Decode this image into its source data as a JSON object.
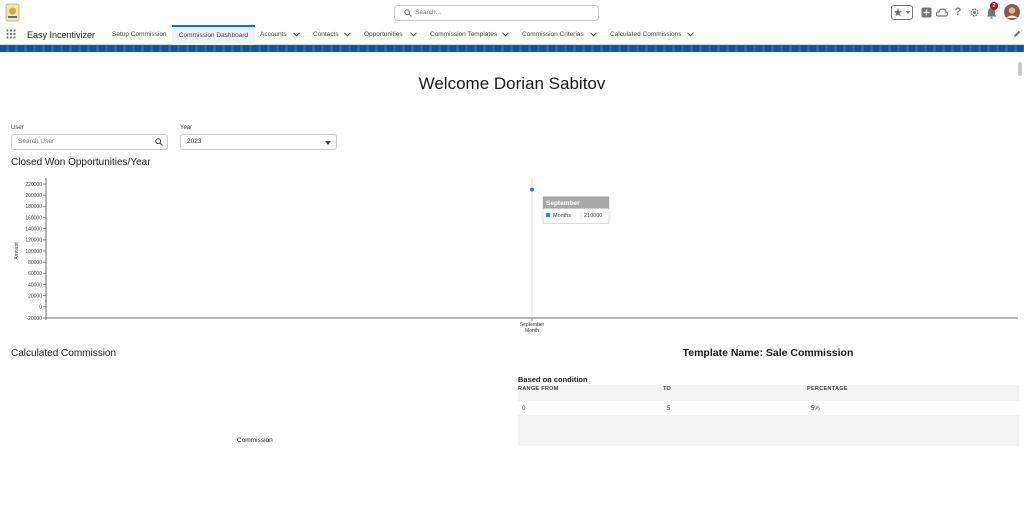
{
  "header": {
    "search_placeholder": "Search...",
    "notification_count": "2"
  },
  "nav": {
    "app_name": "Easy Incentivizer",
    "tabs": [
      {
        "label": "Setup Commission",
        "dropdown": false
      },
      {
        "label": "Commission Dashboard",
        "dropdown": false,
        "active": true
      },
      {
        "label": "Accounts",
        "dropdown": true
      },
      {
        "label": "Contacts",
        "dropdown": true
      },
      {
        "label": "Opportunities",
        "dropdown": true
      },
      {
        "label": "Commission Templates",
        "dropdown": true
      },
      {
        "label": "Commission Criterias",
        "dropdown": true
      },
      {
        "label": "Calculated Commissions",
        "dropdown": true
      }
    ]
  },
  "page": {
    "welcome": "Welcome Dorian Sabitov",
    "user_label": "User",
    "user_placeholder": "Search User",
    "year_label": "Year",
    "year_value": "2023"
  },
  "sections": {
    "chart_title": "Closed Won Opportunities/Year",
    "calc_title": "Calculated Commission",
    "calc_chart_label": "Commission"
  },
  "chart_data": {
    "type": "line",
    "title": "Closed Won Opportunities/Year",
    "ylabel": "Amount",
    "xlabel": "Month",
    "ylim": [
      -20000,
      220000
    ],
    "yticks": [
      220000,
      200000,
      180000,
      160000,
      140000,
      120000,
      100000,
      80000,
      60000,
      40000,
      20000,
      0,
      -20000
    ],
    "categories": [
      "September"
    ],
    "series": [
      {
        "name": "Months",
        "values": [
          210000
        ]
      }
    ],
    "tooltip": {
      "title": "September",
      "series": "Months",
      "value": "210000"
    },
    "colors": {
      "series": "#1589ee"
    }
  },
  "template": {
    "name": "Template Name: Sale Commission",
    "condition_label": "Based on condition",
    "columns": [
      "RANGE FROM",
      "TO",
      "PERCENTAGE"
    ],
    "rows": [
      [
        "0",
        "5",
        "5%"
      ]
    ]
  },
  "colors": {
    "brand_blue": "#0176d3",
    "band_blue": "#1b5297"
  }
}
